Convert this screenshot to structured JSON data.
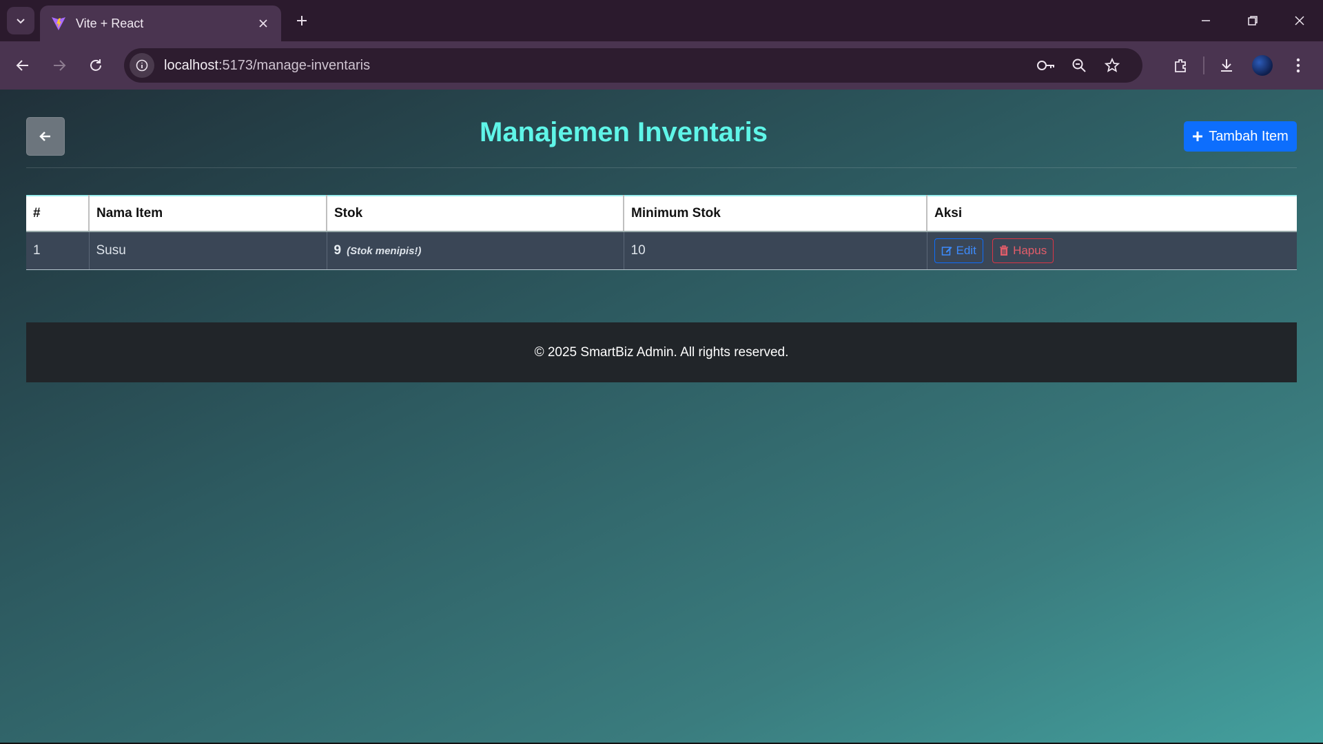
{
  "browser": {
    "tab_title": "Vite + React",
    "url_host": "localhost",
    "url_path": ":5173/manage-inventaris"
  },
  "page": {
    "title": "Manajemen Inventaris",
    "add_button_label": "Tambah Item"
  },
  "table": {
    "headers": [
      "#",
      "Nama Item",
      "Stok",
      "Minimum Stok",
      "Aksi"
    ],
    "rows": [
      {
        "no": "1",
        "name": "Susu",
        "stock": "9",
        "stock_warning": "(Stok menipis!)",
        "min_stock": "10",
        "edit_label": "Edit",
        "delete_label": "Hapus"
      }
    ]
  },
  "footer": {
    "text": "© 2025 SmartBiz Admin. All rights reserved."
  },
  "colors": {
    "title": "#5ff5e8",
    "primary": "#0d6efd",
    "danger": "#dc3545",
    "footer_bg": "#212529"
  }
}
